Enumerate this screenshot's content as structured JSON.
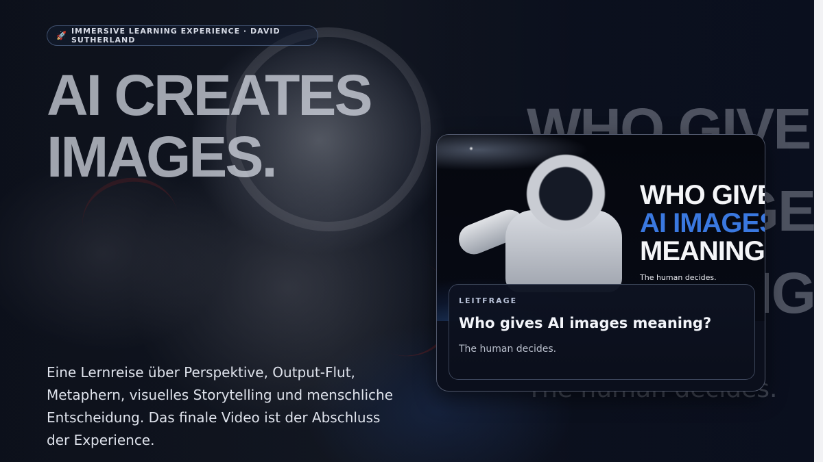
{
  "badge": {
    "icon": "rocket-icon",
    "label": "IMMERSIVE LEARNING EXPERIENCE · DAVID SUTHERLAND"
  },
  "headline": {
    "line1": "AI CREATES",
    "line2": "IMAGES."
  },
  "intro": "Eine Lernreise über Perspektive, Output-Flut, Metaphern, visuelles Storytelling und menschliche Entscheidung. Das finale Video ist der Abschluss der Experience.",
  "background_poster_text": {
    "line1": "WHO GIVE",
    "line2": "GE",
    "line3": "NG",
    "subtitle": "The human decides."
  },
  "card": {
    "poster": {
      "line1": "WHO GIVES",
      "line2": "AI IMAGES",
      "line3": "MEANING?",
      "subtitle": "The human decides."
    },
    "kicker": "LEITFRAGE",
    "title": "Who gives AI images meaning?",
    "description": "The human decides."
  },
  "colors": {
    "accent_blue": "#3a78e0",
    "background": "#0b1020"
  }
}
